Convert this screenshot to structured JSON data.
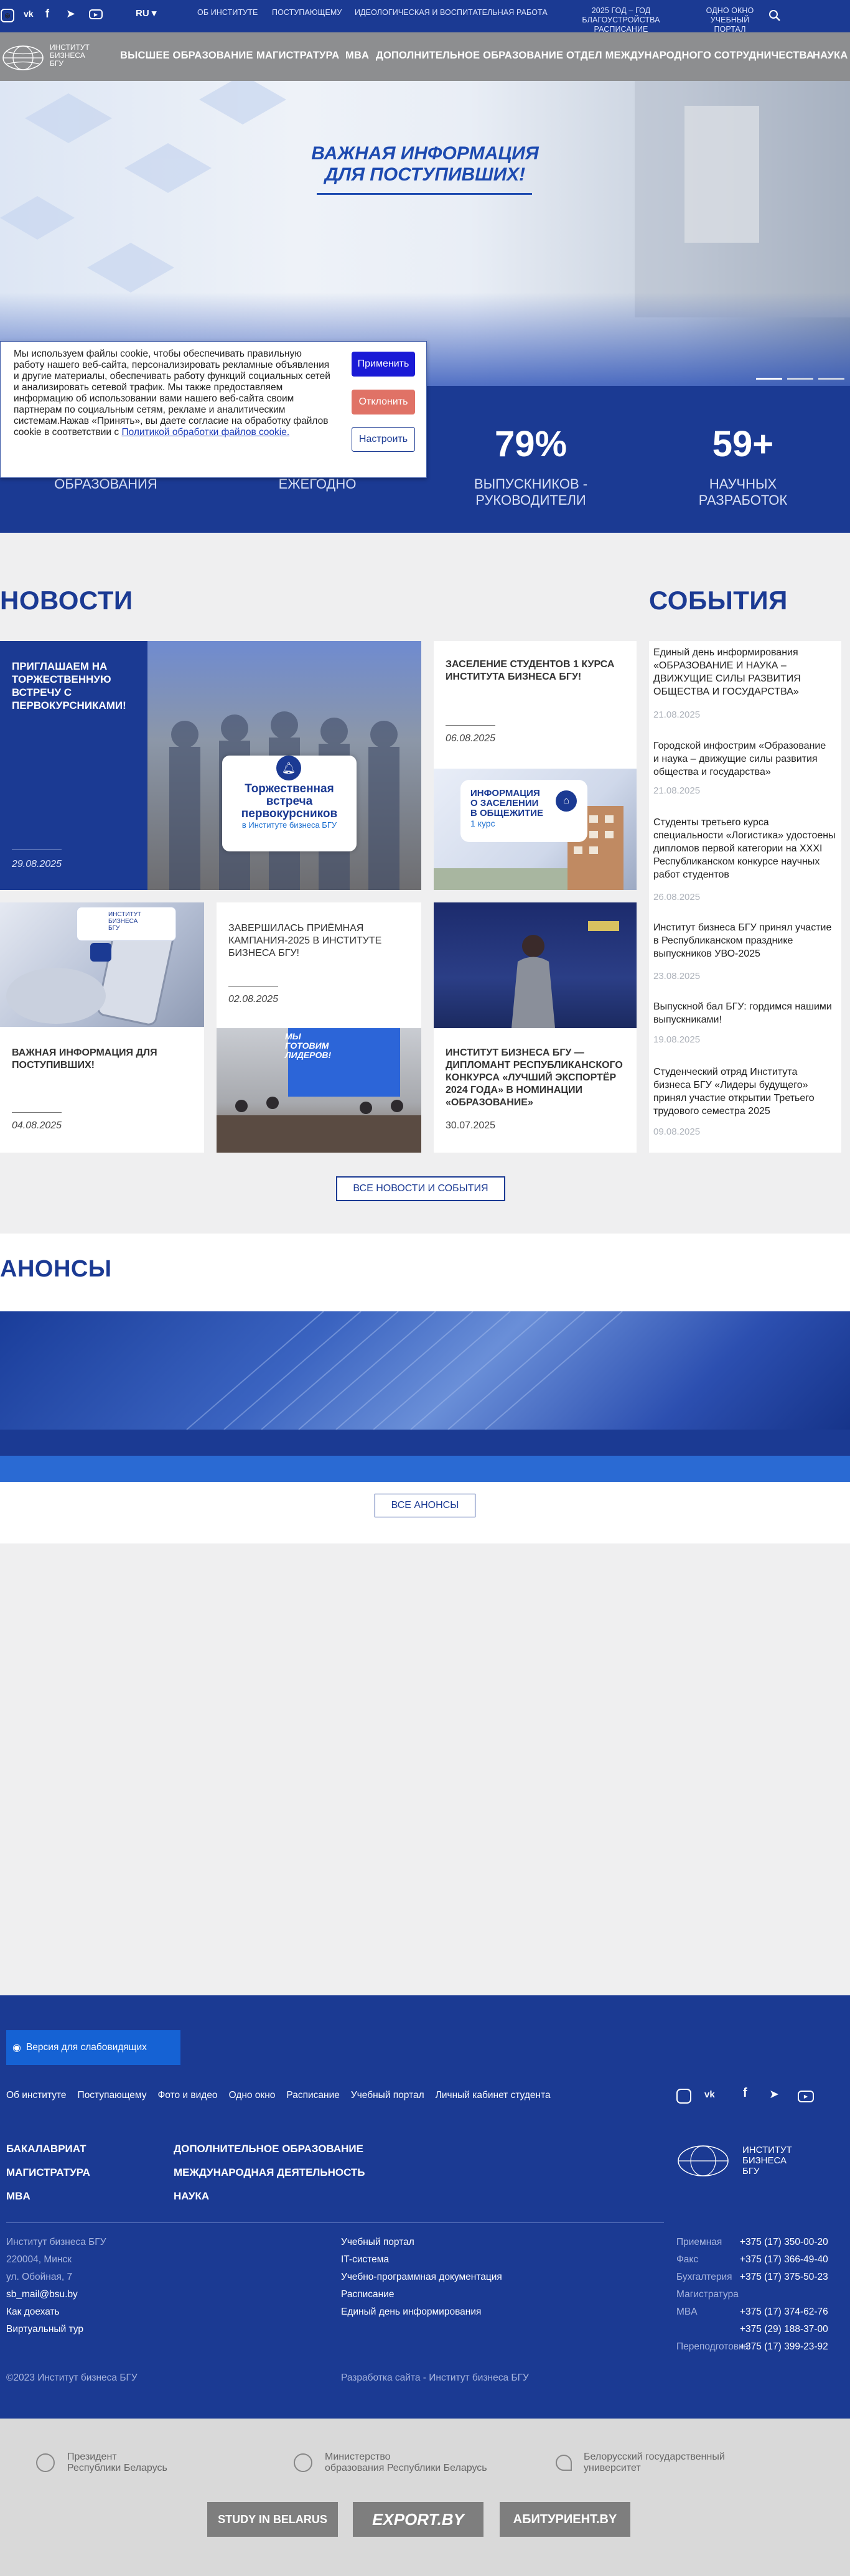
{
  "colors": {
    "primary": "#1b3a93",
    "header_grey": "#8d8e90",
    "accept": "#1a1ad6",
    "reject": "#e07266"
  },
  "top_nav": {
    "lang": "RU ▾",
    "items": [
      "ОБ ИНСТИТУТЕ",
      "ПОСТУПАЮЩЕМУ",
      "ИДЕОЛОГИЧЕСКАЯ И ВОСПИТАТЕЛЬНАЯ РАБОТА"
    ],
    "item_2025": [
      "2025 ГОД – ГОД БЛАГОУСТРОЙСТВА",
      "РАСПИСАНИЕ"
    ],
    "item_window": [
      "ОДНО ОКНО",
      "УЧЕБНЫЙ ПОРТАЛ"
    ],
    "icons": [
      "instagram-icon",
      "vk-icon",
      "facebook-icon",
      "telegram-icon",
      "youtube-icon",
      "search-icon"
    ]
  },
  "header": {
    "logo_lines": [
      "ИНСТИТУТ",
      "БИЗНЕСА",
      "БГУ"
    ],
    "nav": [
      "ВЫСШЕЕ ОБРАЗОВАНИЕ",
      "МАГИСТРАТУРА",
      "MBA",
      "ДОПОЛНИТЕЛЬНОЕ ОБРАЗОВАНИЕ",
      "ОТДЕЛ МЕЖДУНАРОДНОГО СОТРУДНИЧЕСТВА",
      "НАУКА"
    ]
  },
  "hero": {
    "title_line1": "ВАЖНАЯ ИНФОРМАЦИЯ",
    "title_line2": "ДЛЯ ПОСТУПИВШИХ!"
  },
  "stats": [
    {
      "number": "",
      "label": "ОБРАЗОВАНИЯ"
    },
    {
      "number": "",
      "label": "ЕЖЕГОДНО"
    },
    {
      "number": "79%",
      "label": "ВЫПУСКНИКОВ -\nРУКОВОДИТЕЛИ"
    },
    {
      "number": "59+",
      "label": "НАУЧНЫХ\nРАЗРАБОТОК"
    }
  ],
  "cookie": {
    "text": "Мы используем файлы cookie, чтобы обеспечивать правильную работу нашего веб-сайта, персонализировать рекламные объявления и другие материалы, обеспечивать работу функций социальных сетей и анализировать сетевой трафик. Мы также предоставляем информацию об использовании вами нашего веб-сайта своим партнерам по социальным сетям, рекламе и аналитическим системам.Нажав «Принять», вы даете согласие на обработку файлов cookie в соответствии с ",
    "link": "Политикой обработки файлов cookie.",
    "accept": "Применить",
    "reject": "Отклонить",
    "configure": "Настроить"
  },
  "news": {
    "heading": "НОВОСТИ",
    "items": [
      {
        "title": "ПРИГЛАШАЕМ НА ТОРЖЕСТВЕННУЮ ВСТРЕЧУ С ПЕРВОКУРСНИКАМИ!",
        "date": "29.08.2025",
        "img_text": [
          "Торжественная",
          "встреча",
          "первокурсников"
        ],
        "img_sub": "в Институте бизнеса БГУ"
      },
      {
        "title": "ЗАСЕЛЕНИЕ СТУДЕНТОВ 1 КУРСА ИНСТИТУТА БИЗНЕСА БГУ!",
        "date": "06.08.2025",
        "img_text": [
          "ИНФОРМАЦИЯ",
          "О ЗАСЕЛЕНИИ",
          "В ОБЩЕЖИТИЕ"
        ],
        "img_sub": "1 курс"
      },
      {
        "title": "ВАЖНАЯ ИНФОРМАЦИЯ ДЛЯ ПОСТУПИВШИХ!",
        "date": "04.08.2025",
        "img_logo": [
          "ИНСТИТУТ",
          "БИЗНЕСА",
          "БГУ"
        ]
      },
      {
        "title": "ЗАВЕРШИЛАСЬ ПРИЁМНАЯ КАМПАНИЯ-2025 В ИНСТИТУТЕ БИЗНЕСА БГУ!",
        "date": "02.08.2025",
        "img_text": [
          "МЫ",
          "ГОТОВИМ",
          "ЛИДЕРОВ!"
        ]
      },
      {
        "title": "ИНСТИТУТ БИЗНЕСА БГУ — ДИПЛОМАНТ РЕСПУБЛИКАНСКОГО КОНКУРСА «ЛУЧШИЙ ЭКСПОРТЁР 2024 ГОДА» В НОМИНАЦИИ «ОБРАЗОВАНИЕ»",
        "date": "30.07.2025"
      }
    ]
  },
  "events": {
    "heading": "СОБЫТИЯ",
    "items": [
      {
        "title": "Единый день информирования «ОБРАЗОВАНИЕ И НАУКА – ДВИЖУЩИЕ СИЛЫ РАЗВИТИЯ ОБЩЕСТВА И ГОСУДАРСТВА»",
        "date": "21.08.2025"
      },
      {
        "title": "Городской инфострим «Образование и наука – движущие силы развития общества и государства»",
        "date": "21.08.2025"
      },
      {
        "title": "Студенты третьего курса специальности «Логистика» удостоены дипломов первой категории на XXXI Республиканском конкурсе научных работ студентов",
        "date": "26.08.2025"
      },
      {
        "title": "Институт бизнеса БГУ принял участие в Республиканском празднике выпускников УВО-2025",
        "date": "23.08.2025"
      },
      {
        "title": "Выпускной бал БГУ: гордимся нашими выпускниками!",
        "date": "19.08.2025"
      },
      {
        "title": "Студенческий отряд Института бизнеса БГУ «Лидеры будущего» принял участие открытии Третьего трудового семестра 2025",
        "date": "09.08.2025"
      }
    ]
  },
  "all_news_button": "ВСЕ НОВОСТИ И СОБЫТИЯ",
  "announcements": {
    "heading": "АНОНСЫ",
    "button": "ВСЕ АНОНСЫ"
  },
  "footer": {
    "accessibility": "Версия для слабовидящих",
    "links": [
      "Об институте",
      "Поступающему",
      "Фото и видео",
      "Одно окно",
      "Расписание",
      "Учебный портал",
      "Личный кабинет студента"
    ],
    "col1": [
      "БАКАЛАВРИАТ",
      "МАГИСТРАТУРА",
      "MBA"
    ],
    "col2": [
      "ДОПОЛНИТЕЛЬНОЕ ОБРАЗОВАНИЕ",
      "МЕЖДУНАРОДНАЯ ДЕЯТЕЛЬНОСТЬ",
      "НАУКА"
    ],
    "logo_lines": [
      "ИНСТИТУТ",
      "БИЗНЕСА",
      "БГУ"
    ],
    "address": [
      "Институт бизнеса БГУ",
      "220004, Минск",
      "ул. Обойная, 7"
    ],
    "email": "sb_mail@bsu.by",
    "how_to": "Как доехать",
    "tour": "Виртуальный тур",
    "mid_links": [
      "Учебный портал",
      "IT-система",
      "Учебно-программная документация",
      "Расписание",
      "Единый день информирования"
    ],
    "contacts": [
      {
        "label": "Приемная",
        "phone": "+375 (17) 350-00-20"
      },
      {
        "label": "Факс",
        "phone": "+375 (17) 366-49-40"
      },
      {
        "label": "Бухгалтерия",
        "phone": "+375 (17) 375-50-23"
      },
      {
        "label": "Магистратура",
        "phone": ""
      },
      {
        "label": "MBA",
        "phone": "+375 (17) 374-62-76"
      },
      {
        "label": "",
        "phone": "+375 (29) 188-37-00"
      },
      {
        "label": "Переподготовка",
        "phone": "+375 (17) 399-23-92"
      }
    ],
    "copyright": "©2023 Институт бизнеса БГУ",
    "dev": "Разработка сайта - Институт бизнеса БГУ"
  },
  "partners": [
    {
      "line1": "Президент",
      "line2": "Республики Беларусь"
    },
    {
      "line1": "Министерство",
      "line2": "образования Республики Беларусь"
    },
    {
      "line1": "Белорусский государственный",
      "line2": "университет"
    }
  ],
  "badges": [
    "STUDY IN BELARUS",
    "EXPORT.BY",
    "АБИТУРИЕНТ.BY"
  ]
}
